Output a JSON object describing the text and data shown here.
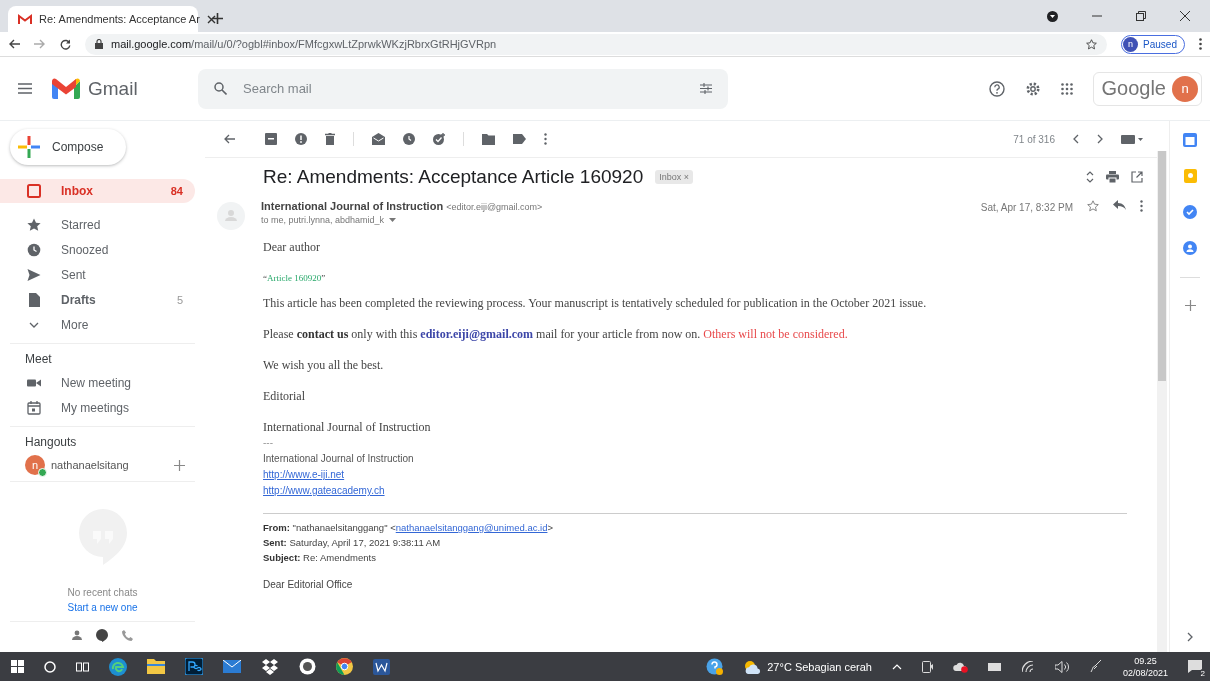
{
  "browser": {
    "tab_title": "Re: Amendments: Acceptance Ar",
    "address_domain": "mail.google.com",
    "address_path": "/mail/u/0/?ogbl#inbox/FMfcgxwLtZprwkWKzjRbrxGtRHjGVRpn",
    "profile_initial": "n",
    "profile_status": "Paused"
  },
  "header": {
    "logo_text": "Gmail",
    "search": {
      "placeholder": "Search mail"
    },
    "account_brand": "Google",
    "avatar_initial": "n"
  },
  "sidebar": {
    "compose": "Compose",
    "items": [
      {
        "label": "Inbox",
        "count": "84",
        "selected": true,
        "unread": true
      },
      {
        "label": "Starred",
        "selected": false,
        "unread": false
      },
      {
        "label": "Snoozed",
        "selected": false,
        "unread": false
      },
      {
        "label": "Sent",
        "selected": false,
        "unread": false
      },
      {
        "label": "Drafts",
        "count": "5",
        "selected": false,
        "unread": true
      },
      {
        "label": "More",
        "selected": false,
        "unread": false
      }
    ],
    "meet": {
      "heading": "Meet",
      "items": [
        "New meeting",
        "My meetings"
      ]
    },
    "hangouts": {
      "heading": "Hangouts",
      "contacts": [
        {
          "initial": "n",
          "name": "nathanaelsitang",
          "online": true
        }
      ]
    },
    "chats": {
      "empty_text": "No recent chats",
      "link": "Start a new one"
    }
  },
  "toolbar": {
    "counter": "71 of 316"
  },
  "email": {
    "subject": "Re: Amendments: Acceptance Article 160920",
    "label": "Inbox",
    "label_remove": "×",
    "sender_name": "International Journal of Instruction",
    "sender_address": "<editor.eiji@gmail.com>",
    "recipients": "to me, putri.lynna, abdhamid_k",
    "date": "Sat, Apr 17, 8:32 PM",
    "body": [
      {
        "kind": "serif",
        "segments": [
          {
            "kind": "text",
            "text": "Dear author"
          }
        ]
      },
      {
        "kind": "small",
        "segments": [
          {
            "kind": "text",
            "text": "“"
          },
          {
            "kind": "highlight",
            "text": "Article 160920"
          },
          {
            "kind": "text",
            "text": "”"
          }
        ]
      },
      {
        "kind": "serif",
        "segments": [
          {
            "kind": "text",
            "text": "This article has been completed the reviewing process. Your manuscript is tentatively scheduled for publication in the October 2021 issue."
          }
        ]
      },
      {
        "kind": "serif",
        "segments": [
          {
            "kind": "text",
            "text": "Please "
          },
          {
            "kind": "emphasis",
            "text": "contact us"
          },
          {
            "kind": "text",
            "text": " only with this "
          },
          {
            "kind": "address",
            "text": "editor.eiji@gmail.com"
          },
          {
            "kind": "text",
            "text": " mail for your article from now on. "
          },
          {
            "kind": "warning",
            "text": "Others will not be considered."
          }
        ]
      },
      {
        "kind": "serif",
        "segments": [
          {
            "kind": "text",
            "text": "We wish you all the best."
          }
        ]
      },
      {
        "kind": "serif",
        "segments": [
          {
            "kind": "text",
            "text": "Editorial"
          }
        ]
      },
      {
        "kind": "serif",
        "segments": [
          {
            "kind": "text",
            "text": "International Journal of Instruction"
          }
        ]
      }
    ],
    "signature": {
      "dashes": "---",
      "name": "International Journal of Instruction",
      "links": [
        "http://www.e-iji.net",
        "http://www.gateacademy.ch"
      ]
    },
    "quoted": {
      "from_label": "From:",
      "from_name": "\"nathanaelsitanggang\" <",
      "from_address": "nathanaelsitanggang@unimed.ac.id",
      "from_end": ">",
      "sent_label": "Sent:",
      "sent": "Saturday, April 17, 2021 9:38:11 AM",
      "subject_label": "Subject:",
      "subject": "Re: Amendments",
      "greeting": "Dear Editorial Office"
    }
  },
  "taskbar": {
    "weather": "27°C Sebagian cerah",
    "time": "09.25",
    "date": "02/08/2021",
    "notifications": "2"
  }
}
